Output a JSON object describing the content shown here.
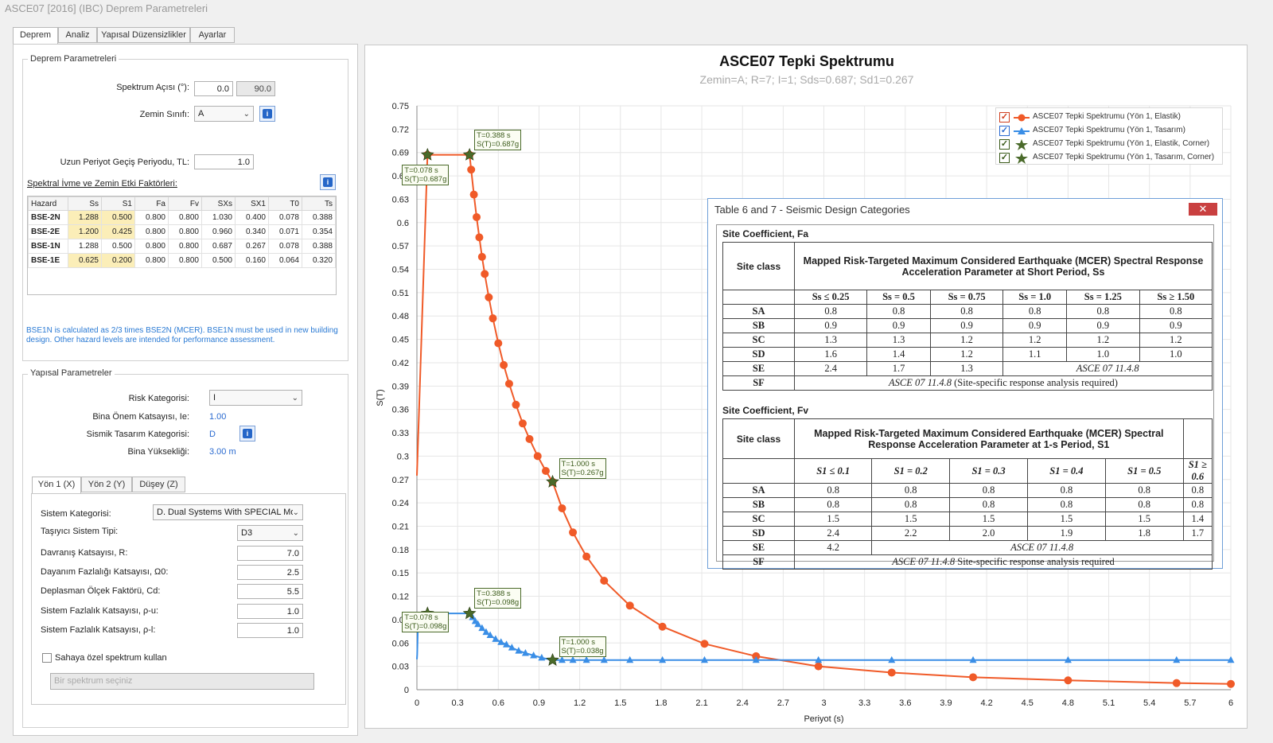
{
  "window": {
    "title": "ASCE07 [2016] (IBC) Deprem Parametreleri"
  },
  "tabs": [
    "Deprem",
    "Analiz",
    "Yapısal Düzensizlikler",
    "Ayarlar"
  ],
  "deprem_group": {
    "title": "Deprem Parametreleri",
    "spectrum_angle_label": "Spektrum Açısı (°):",
    "spectrum_angle_1": "0.0",
    "spectrum_angle_2": "90.0",
    "soil_class_label": "Zemin Sınıfı:",
    "soil_class_value": "A",
    "tl_label": "Uzun Periyot Geçiş Periyodu, TL:",
    "tl_value": "1.0",
    "factors_link": "Spektral İvme ve Zemin Etki Faktörleri:",
    "table_headers": [
      "Hazard",
      "Ss",
      "S1",
      "Fa",
      "Fv",
      "SXs",
      "SX1",
      "T0",
      "Ts"
    ],
    "table_rows": [
      [
        "BSE-2N",
        "1.288",
        "0.500",
        "0.800",
        "0.800",
        "1.030",
        "0.400",
        "0.078",
        "0.388"
      ],
      [
        "BSE-2E",
        "1.200",
        "0.425",
        "0.800",
        "0.800",
        "0.960",
        "0.340",
        "0.071",
        "0.354"
      ],
      [
        "BSE-1N",
        "1.288",
        "0.500",
        "0.800",
        "0.800",
        "0.687",
        "0.267",
        "0.078",
        "0.388"
      ],
      [
        "BSE-1E",
        "0.625",
        "0.200",
        "0.800",
        "0.800",
        "0.500",
        "0.160",
        "0.064",
        "0.320"
      ]
    ],
    "note": "BSE1N is calculated as 2/3 times BSE2N (MCER). BSE1N must be used in new building design. Other hazard levels are intended for performance assessment."
  },
  "yapisal_group": {
    "title": "Yapısal Parametreler",
    "risk_label": "Risk Kategorisi:",
    "risk_value": "I",
    "ie_label": "Bina Önem Katsayısı, Ie:",
    "ie_value": "1.00",
    "sdc_label": "Sismik Tasarım Kategorisi:",
    "sdc_value": "D",
    "height_label": "Bina Yüksekliği:",
    "height_value": "3.00 m",
    "dir_tabs": [
      "Yön 1 (X)",
      "Yön 2 (Y)",
      "Düşey (Z)"
    ],
    "system_cat_label": "Sistem Kategorisi:",
    "system_cat_value": "D. Dual Systems With SPECIAL Mor",
    "system_type_label": "Taşıyıcı Sistem Tipi:",
    "system_type_value": "D3",
    "r_label": "Davranış Katsayısı, R:",
    "r_value": "7.0",
    "omega_label": "Dayanım Fazlalığı Katsayısı, Ω0:",
    "omega_value": "2.5",
    "cd_label": "Deplasman Ölçek Faktörü, Cd:",
    "cd_value": "5.5",
    "rho_u_label": "Sistem Fazlalık Katsayısı, ρ-u:",
    "rho_u_value": "1.0",
    "rho_l_label": "Sistem Fazlalık Katsayısı, ρ-l:",
    "rho_l_value": "1.0",
    "site_spec_label": "Sahaya özel spektrum kullan",
    "spectrum_placeholder": "Bir spektrum seçiniz"
  },
  "chart_data": {
    "type": "line",
    "title": "ASCE07 Tepki Spektrumu",
    "subtitle": "Zemin=A; R=7; I=1; Sds=0.687; Sd1=0.267",
    "xlabel": "Periyot (s)",
    "ylabel": "S(T)",
    "xlim": [
      0,
      6
    ],
    "ylim": [
      0,
      0.75
    ],
    "x_ticks": [
      "0",
      "0.3",
      "0.6",
      "0.9",
      "1.2",
      "1.5",
      "1.8",
      "2.1",
      "2.4",
      "2.7",
      "3",
      "3.3",
      "3.6",
      "3.9",
      "4.2",
      "4.5",
      "4.8",
      "5.1",
      "5.4",
      "5.7",
      "6"
    ],
    "y_ticks": [
      "0",
      "0.03",
      "0.06",
      "0.09",
      "0.12",
      "0.15",
      "0.18",
      "0.21",
      "0.24",
      "0.27",
      "0.3",
      "0.33",
      "0.36",
      "0.39",
      "0.42",
      "0.45",
      "0.48",
      "0.51",
      "0.54",
      "0.57",
      "0.6",
      "0.63",
      "0.66",
      "0.69",
      "0.72",
      "0.75"
    ],
    "grid": true,
    "legend_position": "top-right",
    "series": [
      {
        "name": "ASCE07 Tepki Spektrumu (Yön 1, Elastik)",
        "color": "#f05a28",
        "marker": "circle",
        "x": [
          0,
          0.078,
          0.388,
          0.4,
          0.42,
          0.44,
          0.46,
          0.48,
          0.5,
          0.53,
          0.56,
          0.6,
          0.64,
          0.68,
          0.73,
          0.78,
          0.83,
          0.89,
          0.95,
          1.0,
          1.07,
          1.15,
          1.25,
          1.38,
          1.57,
          1.81,
          2.12,
          2.5,
          2.96,
          3.5,
          4.1,
          4.8,
          5.6,
          6.0
        ],
        "y": [
          0.275,
          0.687,
          0.687,
          0.668,
          0.636,
          0.607,
          0.581,
          0.556,
          0.534,
          0.504,
          0.477,
          0.445,
          0.417,
          0.393,
          0.366,
          0.342,
          0.322,
          0.3,
          0.281,
          0.267,
          0.233,
          0.202,
          0.171,
          0.14,
          0.108,
          0.081,
          0.059,
          0.043,
          0.03,
          0.022,
          0.016,
          0.012,
          0.0085,
          0.0074
        ]
      },
      {
        "name": "ASCE07 Tepki Spektrumu (Yön 1, Tasarım)",
        "color": "#3a8ee6",
        "marker": "triangle",
        "x": [
          0,
          0.002,
          0.01,
          0.078,
          0.388,
          0.41,
          0.43,
          0.45,
          0.48,
          0.51,
          0.54,
          0.58,
          0.62,
          0.66,
          0.7,
          0.75,
          0.8,
          0.86,
          0.92,
          1.0,
          1.07,
          1.15,
          1.25,
          1.38,
          1.57,
          1.81,
          2.12,
          2.5,
          2.96,
          3.5,
          4.1,
          4.8,
          5.6,
          6.0
        ],
        "y": [
          0.039,
          0.045,
          0.098,
          0.098,
          0.098,
          0.093,
          0.088,
          0.084,
          0.079,
          0.074,
          0.07,
          0.065,
          0.061,
          0.058,
          0.054,
          0.05,
          0.047,
          0.044,
          0.041,
          0.038,
          0.038,
          0.038,
          0.038,
          0.038,
          0.038,
          0.038,
          0.038,
          0.038,
          0.038,
          0.038,
          0.038,
          0.038,
          0.038,
          0.038
        ]
      },
      {
        "name": "ASCE07 Tepki Spektrumu (Yön 1, Elastik, Corner)",
        "color": "#4a6a2a",
        "marker": "star",
        "x": [
          0.078,
          0.388,
          1.0
        ],
        "y": [
          0.687,
          0.687,
          0.267
        ]
      },
      {
        "name": "ASCE07 Tepki Spektrumu (Yön 1, Tasarım, Corner)",
        "color": "#4a6a2a",
        "marker": "star",
        "x": [
          0.078,
          0.388,
          1.0
        ],
        "y": [
          0.098,
          0.098,
          0.038
        ]
      }
    ],
    "annotations": [
      {
        "x": 0.078,
        "y": 0.687,
        "text": "T=0.078 s\nS(T)=0.687g"
      },
      {
        "x": 0.388,
        "y": 0.687,
        "text": "T=0.388 s\nS(T)=0.687g"
      },
      {
        "x": 1.0,
        "y": 0.267,
        "text": "T=1.000 s\nS(T)=0.267g"
      },
      {
        "x": 0.388,
        "y": 0.098,
        "text": "T=0.388 s\nS(T)=0.098g"
      },
      {
        "x": 0.078,
        "y": 0.098,
        "text": "T=0.078 s\nS(T)=0.098g"
      },
      {
        "x": 1.0,
        "y": 0.038,
        "text": "T=1.000 s\nS(T)=0.038g"
      }
    ]
  },
  "legend": {
    "items": [
      {
        "label": "ASCE07 Tepki Spektrumu (Yön 1, Elastik)",
        "checked": true,
        "check_color": "#d04020"
      },
      {
        "label": "ASCE07 Tepki Spektrumu (Yön 1, Tasarım)",
        "checked": true,
        "check_color": "#2a6ad0"
      },
      {
        "label": "ASCE07 Tepki Spektrumu (Yön 1, Elastik, Corner)",
        "checked": true,
        "check_color": "#3a5a1a"
      },
      {
        "label": "ASCE07 Tepki Spektrumu (Yön 1, Tasarım, Corner)",
        "checked": true,
        "check_color": "#3a5a1a"
      }
    ]
  },
  "popup": {
    "title": "Table 6 and 7 - Seismic Design Categories",
    "fa": {
      "title": "Site Coefficient, Fa",
      "site_class": "Site class",
      "header": "Mapped Risk-Targeted Maximum Considered Earthquake (MCER) Spectral Response Acceleration Parameter at Short Period, Ss",
      "cols": [
        "Ss ≤ 0.25",
        "Ss = 0.5",
        "Ss = 0.75",
        "Ss = 1.0",
        "Ss = 1.25",
        "Ss ≥ 1.50"
      ],
      "rows": [
        [
          "SA",
          "0.8",
          "0.8",
          "0.8",
          "0.8",
          "0.8",
          "0.8"
        ],
        [
          "SB",
          "0.9",
          "0.9",
          "0.9",
          "0.9",
          "0.9",
          "0.9"
        ],
        [
          "SC",
          "1.3",
          "1.3",
          "1.2",
          "1.2",
          "1.2",
          "1.2"
        ],
        [
          "SD",
          "1.6",
          "1.4",
          "1.2",
          "1.1",
          "1.0",
          "1.0"
        ]
      ],
      "se": [
        "SE",
        "2.4",
        "1.7",
        "1.3",
        "ASCE 07 11.4.8"
      ],
      "sf": [
        "SF",
        "ASCE 07 11.4.8",
        " (Site-specific response analysis required)"
      ]
    },
    "fv": {
      "title": "Site Coefficient, Fv",
      "site_class": "Site class",
      "header": "Mapped Risk-Targeted Maximum Considered Earthquake (MCER) Spectral Response Acceleration Parameter at 1-s Period, S1",
      "cols": [
        "S1 ≤ 0.1",
        "S1 = 0.2",
        "S1 = 0.3",
        "S1 = 0.4",
        "S1 = 0.5",
        "S1 ≥ 0.6"
      ],
      "rows": [
        [
          "SA",
          "0.8",
          "0.8",
          "0.8",
          "0.8",
          "0.8",
          "0.8"
        ],
        [
          "SB",
          "0.8",
          "0.8",
          "0.8",
          "0.8",
          "0.8",
          "0.8"
        ],
        [
          "SC",
          "1.5",
          "1.5",
          "1.5",
          "1.5",
          "1.5",
          "1.4"
        ],
        [
          "SD",
          "2.4",
          "2.2",
          "2.0",
          "1.9",
          "1.8",
          "1.7"
        ]
      ],
      "se": [
        "SE",
        "4.2",
        "ASCE 07 11.4.8"
      ],
      "sf": [
        "SF",
        "ASCE 07 11.4.8",
        " Site-specific response analysis required"
      ]
    }
  }
}
